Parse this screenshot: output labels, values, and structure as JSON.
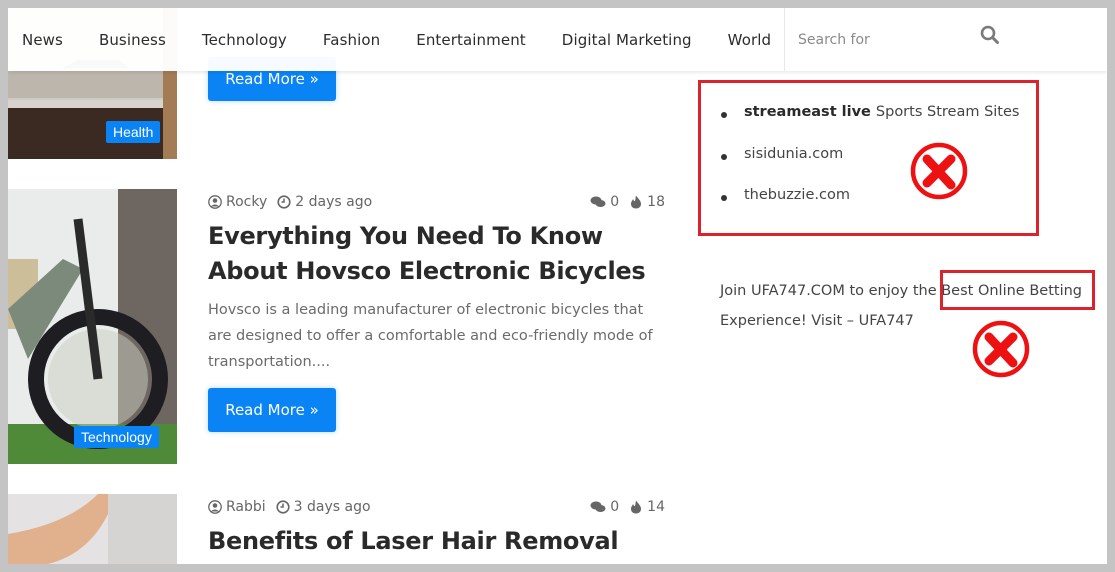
{
  "nav": {
    "items": [
      "News",
      "Business",
      "Technology",
      "Fashion",
      "Entertainment",
      "Digital Marketing",
      "World"
    ],
    "search_placeholder": "Search for",
    "search_icon": "search-icon"
  },
  "posts": [
    {
      "category": "Health",
      "read_more": "Read More »"
    },
    {
      "category": "Technology",
      "author": "Rocky",
      "time": "2 days ago",
      "comments": "0",
      "views": "18",
      "title": "Everything You Need To Know About Hovsco Electronic Bicycles",
      "excerpt": "Hovsco is a leading manufacturer of electronic bicycles that are designed to offer a comfortable and eco-friendly mode of transportation....",
      "read_more": "Read More »"
    },
    {
      "author": "Rabbi",
      "time": "3 days ago",
      "comments": "0",
      "views": "14",
      "title": "Benefits of Laser Hair Removal"
    }
  ],
  "sidebar": {
    "links": [
      {
        "bold": "streameast live",
        "text": "Sports Stream Sites"
      },
      {
        "bold": "",
        "text": "sisidunia.com"
      },
      {
        "bold": "",
        "text": "thebuzzie.com"
      }
    ],
    "promo": {
      "before": "Join UFA747.COM to enjoy the ",
      "highlight": "Best Online Betting",
      "after": " Experience! Visit – UFA747"
    }
  },
  "annotations": {
    "color": "#d9232d",
    "icon": "red-x-circle-icon"
  },
  "colors": {
    "accent": "#0a84f5",
    "annotation": "#d9232d",
    "frame_bg": "#c4c4c4"
  }
}
